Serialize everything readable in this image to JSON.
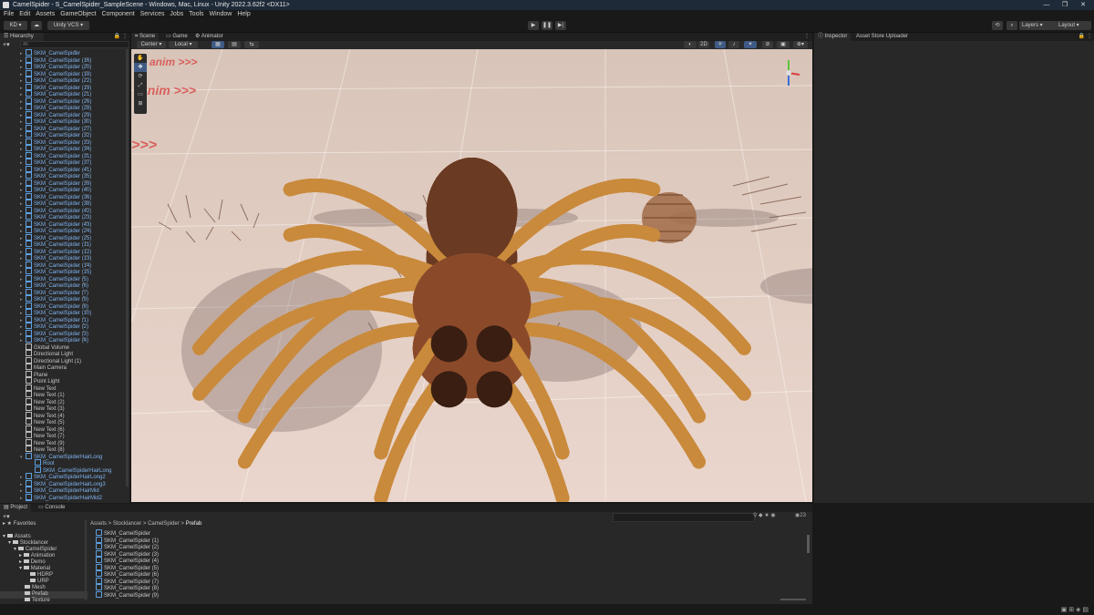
{
  "window": {
    "title": "CamelSpider - S_CamelSpider_SampleScene - Windows, Mac, Linux - Unity 2022.3.62f2 <DX11>"
  },
  "menu": [
    "File",
    "Edit",
    "Assets",
    "GameObject",
    "Component",
    "Services",
    "Jobs",
    "Tools",
    "Window",
    "Help"
  ],
  "toolbar": {
    "account": "KD",
    "vcs": "Unity VCS",
    "layers": "Layers",
    "layout": "Layout"
  },
  "hierarchy": {
    "tab": "Hierarchy",
    "search_placeholder": "All",
    "items": [
      "SKM_CamelSpider",
      "SKM_CamelSpider (16)",
      "SKM_CamelSpider (20)",
      "SKM_CamelSpider (18)",
      "SKM_CamelSpider (22)",
      "SKM_CamelSpider (19)",
      "SKM_CamelSpider (21)",
      "SKM_CamelSpider (26)",
      "SKM_CamelSpider (28)",
      "SKM_CamelSpider (29)",
      "SKM_CamelSpider (30)",
      "SKM_CamelSpider (27)",
      "SKM_CamelSpider (32)",
      "SKM_CamelSpider (33)",
      "SKM_CamelSpider (34)",
      "SKM_CamelSpider (31)",
      "SKM_CamelSpider (37)",
      "SKM_CamelSpider (41)",
      "SKM_CamelSpider (35)",
      "SKM_CamelSpider (39)",
      "SKM_CamelSpider (40)",
      "SKM_CamelSpider (36)",
      "SKM_CamelSpider (38)",
      "SKM_CamelSpider (42)",
      "SKM_CamelSpider (23)",
      "SKM_CamelSpider (43)",
      "SKM_CamelSpider (24)",
      "SKM_CamelSpider (25)",
      "SKM_CamelSpider (11)",
      "SKM_CamelSpider (12)",
      "SKM_CamelSpider (13)",
      "SKM_CamelSpider (14)",
      "SKM_CamelSpider (15)",
      "SKM_CamelSpider (5)",
      "SKM_CamelSpider (6)",
      "SKM_CamelSpider (7)",
      "SKM_CamelSpider (9)",
      "SKM_CamelSpider (8)",
      "SKM_CamelSpider (10)",
      "SKM_CamelSpider (1)",
      "SKM_CamelSpider (2)",
      "SKM_CamelSpider (3)",
      "SKM_CamelSpider (4)"
    ],
    "plain_items": [
      "Global Volume",
      "Directional Light",
      "Directional Light (1)",
      "Main Camera",
      "Plane",
      "Point Light",
      "New Text",
      "New Text (1)",
      "New Text (2)",
      "New Text (3)",
      "New Text (4)",
      "New Text (5)",
      "New Text (6)",
      "New Text (7)",
      "New Text (9)",
      "New Text (8)"
    ],
    "hair_items": [
      "SKM_CamelSpiderHairLong",
      "Root",
      "SKM_CamelSpiderHairLong",
      "SKM_CamelSpiderHairLong2",
      "SKM_CamelSpiderHairLong3",
      "SKM_CamelSpiderHairMid",
      "SKM_CamelSpiderHairMid2",
      "SKM_CamelSpiderHairMid3"
    ]
  },
  "scene_tabs": {
    "scene": "Scene",
    "game": "Game",
    "animator": "Animator"
  },
  "scene_toolbar": {
    "pivot": "Center",
    "space": "Local",
    "mode_2d": "2D"
  },
  "scene_text": {
    "anim_label": "anim >>>"
  },
  "inspector": {
    "tab": "Inspector",
    "tab2": "Asset Store Uploader"
  },
  "project": {
    "tab": "Project",
    "tab2": "Console",
    "favorites": "Favorites",
    "tree": [
      "Assets",
      "Stocklancer",
      "CamelSpider",
      "Animation",
      "Demo",
      "Material",
      "HDRP",
      "URP",
      "Mesh",
      "Prefab",
      "Texture"
    ],
    "breadcrumb": [
      "Assets",
      "Stocklancer",
      "CamelSpider",
      "Prefab"
    ],
    "files": [
      "SKM_CamelSpider",
      "SKM_CamelSpider (1)",
      "SKM_CamelSpider (2)",
      "SKM_CamelSpider (3)",
      "SKM_CamelSpider (4)",
      "SKM_CamelSpider (5)",
      "SKM_CamelSpider (6)",
      "SKM_CamelSpider (7)",
      "SKM_CamelSpider (8)",
      "SKM_CamelSpider (9)"
    ],
    "count": "23"
  },
  "colors": {
    "accent": "#7fb4f0",
    "panel": "#282828",
    "bg": "#191919"
  }
}
